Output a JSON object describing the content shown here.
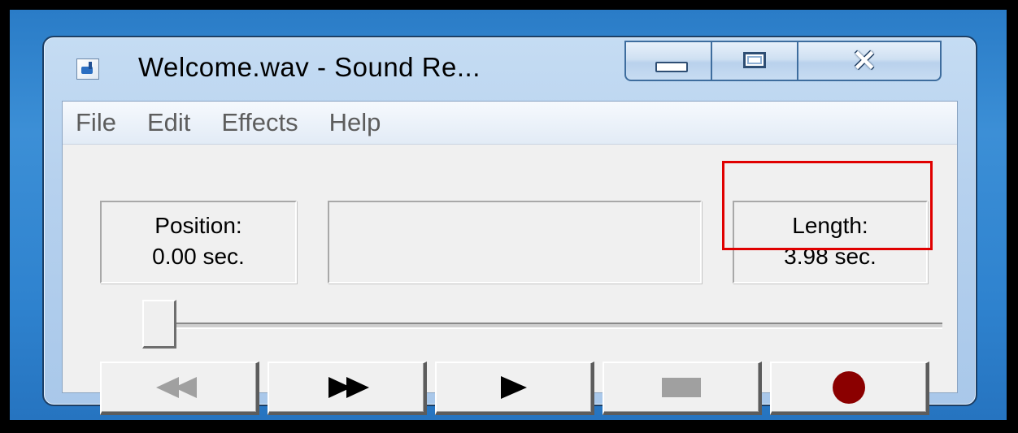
{
  "window": {
    "title": "Welcome.wav - Sound Re...",
    "caption_buttons": {
      "minimize": "minimize-icon",
      "maximize": "maximize-icon",
      "close": "close-icon"
    }
  },
  "menu": [
    "File",
    "Edit",
    "Effects",
    "Help"
  ],
  "position": {
    "label": "Position:",
    "value": "0.00 sec."
  },
  "length": {
    "label": "Length:",
    "value": "3.98 sec."
  },
  "seek": {
    "fraction": 0.0
  },
  "transport": [
    {
      "name": "seek-start",
      "icon": "rewind-icon",
      "enabled": false
    },
    {
      "name": "seek-end",
      "icon": "fast-forward-icon",
      "enabled": true
    },
    {
      "name": "play",
      "icon": "play-icon",
      "enabled": true
    },
    {
      "name": "stop",
      "icon": "stop-icon",
      "enabled": false
    },
    {
      "name": "record",
      "icon": "record-icon",
      "enabled": true
    }
  ],
  "colors": {
    "highlight": "#e00000",
    "record": "#8b0000",
    "desktop": "#2f83cf"
  }
}
